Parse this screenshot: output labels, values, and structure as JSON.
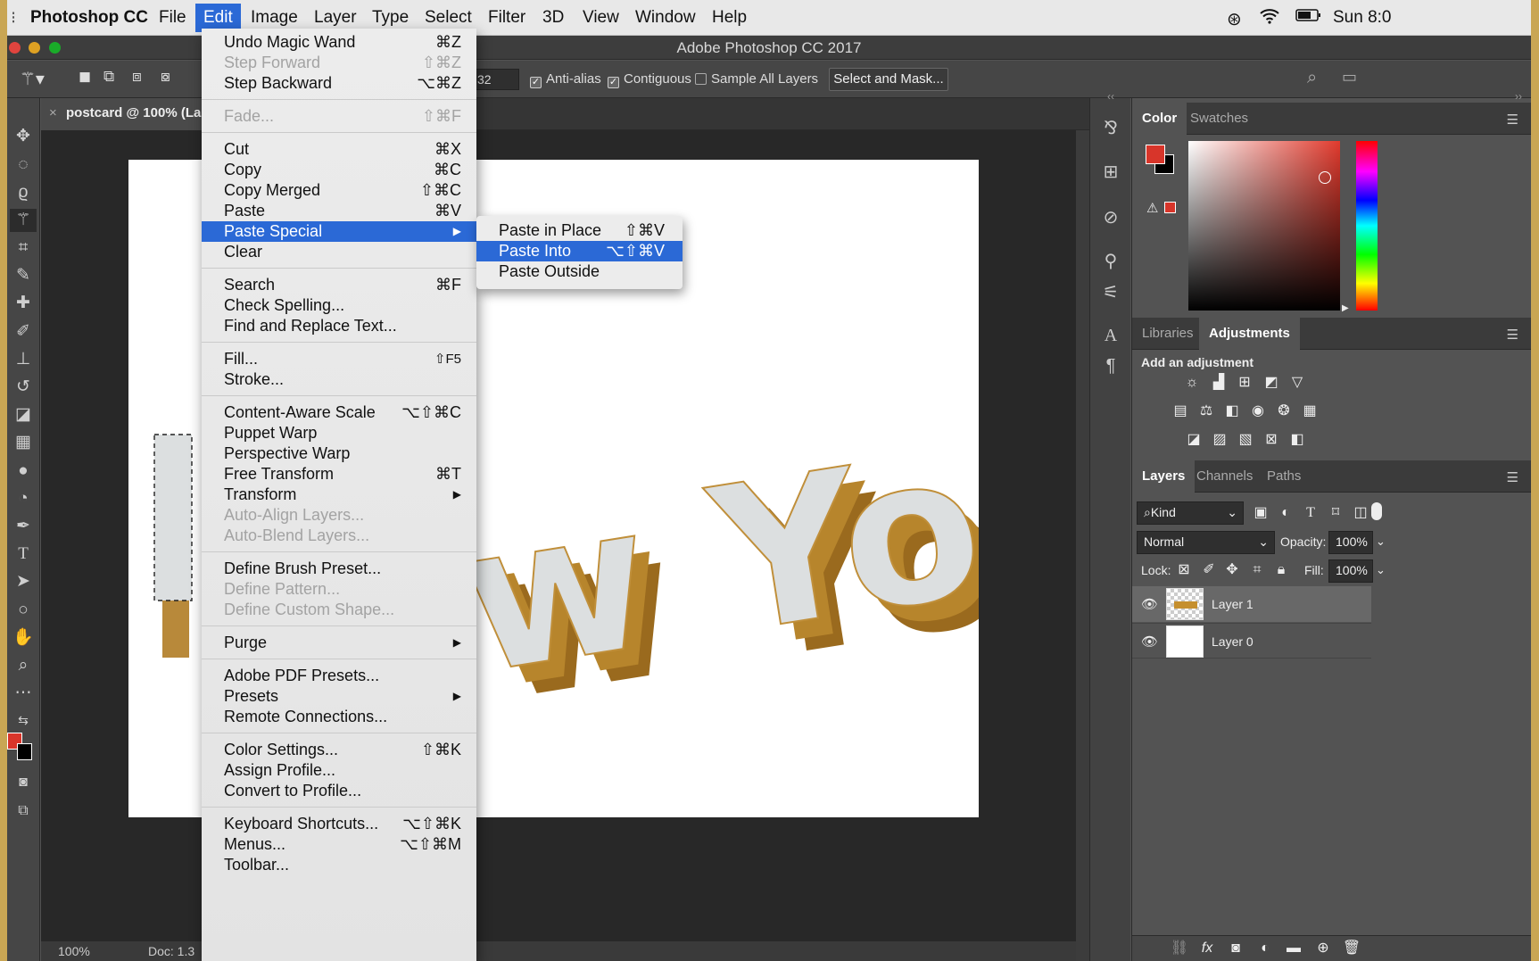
{
  "menubar": {
    "app_name": "Photoshop CC",
    "items": [
      "File",
      "Edit",
      "Image",
      "Layer",
      "Type",
      "Select",
      "Filter",
      "3D",
      "View",
      "Window",
      "Help"
    ],
    "clock": "Sun 8:0"
  },
  "window": {
    "title": "Adobe Photoshop CC 2017"
  },
  "options": {
    "tolerance": "32",
    "anti_alias": "Anti-alias",
    "contiguous": "Contiguous",
    "sample_all": "Sample All Layers",
    "select_mask": "Select and Mask..."
  },
  "document": {
    "tab_title": "postcard @ 100% (La",
    "close": "×",
    "zoom": "100%",
    "doc_info": "Doc: 1.3"
  },
  "canvas_text": "w York",
  "edit_menu": {
    "items": [
      {
        "label": "Undo Magic Wand",
        "shortcut": "⌘Z"
      },
      {
        "label": "Step Forward",
        "shortcut": "⇧⌘Z"
      },
      {
        "label": "Step Backward",
        "shortcut": "⌥⌘Z"
      },
      {
        "label": "Fade...",
        "shortcut": "⇧⌘F"
      },
      {
        "label": "Cut",
        "shortcut": "⌘X"
      },
      {
        "label": "Copy",
        "shortcut": "⌘C"
      },
      {
        "label": "Copy Merged",
        "shortcut": "⇧⌘C"
      },
      {
        "label": "Paste",
        "shortcut": "⌘V"
      },
      {
        "label": "Paste Special",
        "shortcut": "▶"
      },
      {
        "label": "Clear",
        "shortcut": ""
      },
      {
        "label": "Search",
        "shortcut": "⌘F"
      },
      {
        "label": "Check Spelling...",
        "shortcut": ""
      },
      {
        "label": "Find and Replace Text...",
        "shortcut": ""
      },
      {
        "label": "Fill...",
        "shortcut": "⇧F5"
      },
      {
        "label": "Stroke...",
        "shortcut": ""
      },
      {
        "label": "Content-Aware Scale",
        "shortcut": "⌥⇧⌘C"
      },
      {
        "label": "Puppet Warp",
        "shortcut": ""
      },
      {
        "label": "Perspective Warp",
        "shortcut": ""
      },
      {
        "label": "Free Transform",
        "shortcut": "⌘T"
      },
      {
        "label": "Transform",
        "shortcut": "▶"
      },
      {
        "label": "Auto-Align Layers...",
        "shortcut": ""
      },
      {
        "label": "Auto-Blend Layers...",
        "shortcut": ""
      },
      {
        "label": "Define Brush Preset...",
        "shortcut": ""
      },
      {
        "label": "Define Pattern...",
        "shortcut": ""
      },
      {
        "label": "Define Custom Shape...",
        "shortcut": ""
      },
      {
        "label": "Purge",
        "shortcut": "▶"
      },
      {
        "label": "Adobe PDF Presets...",
        "shortcut": ""
      },
      {
        "label": "Presets",
        "shortcut": "▶"
      },
      {
        "label": "Remote Connections...",
        "shortcut": ""
      },
      {
        "label": "Color Settings...",
        "shortcut": "⇧⌘K"
      },
      {
        "label": "Assign Profile...",
        "shortcut": ""
      },
      {
        "label": "Convert to Profile...",
        "shortcut": ""
      },
      {
        "label": "Keyboard Shortcuts...",
        "shortcut": "⌥⇧⌘K"
      },
      {
        "label": "Menus...",
        "shortcut": "⌥⇧⌘M"
      },
      {
        "label": "Toolbar...",
        "shortcut": ""
      }
    ]
  },
  "paste_special_menu": {
    "items": [
      {
        "label": "Paste in Place",
        "shortcut": "⇧⌘V"
      },
      {
        "label": "Paste Into",
        "shortcut": "⌥⇧⌘V"
      },
      {
        "label": "Paste Outside",
        "shortcut": ""
      }
    ]
  },
  "color_panel": {
    "tabs": [
      "Color",
      "Swatches"
    ],
    "foreground": "#d8352a",
    "background": "#000000"
  },
  "adjustments_panel": {
    "tabs": [
      "Libraries",
      "Adjustments"
    ],
    "heading": "Add an adjustment"
  },
  "layers_panel": {
    "tabs": [
      "Layers",
      "Channels",
      "Paths"
    ],
    "filter": "Kind",
    "blend_mode": "Normal",
    "opacity_label": "Opacity:",
    "opacity": "100%",
    "lock_label": "Lock:",
    "fill_label": "Fill:",
    "fill": "100%",
    "layers": [
      {
        "name": "Layer 1"
      },
      {
        "name": "Layer 0"
      }
    ]
  }
}
